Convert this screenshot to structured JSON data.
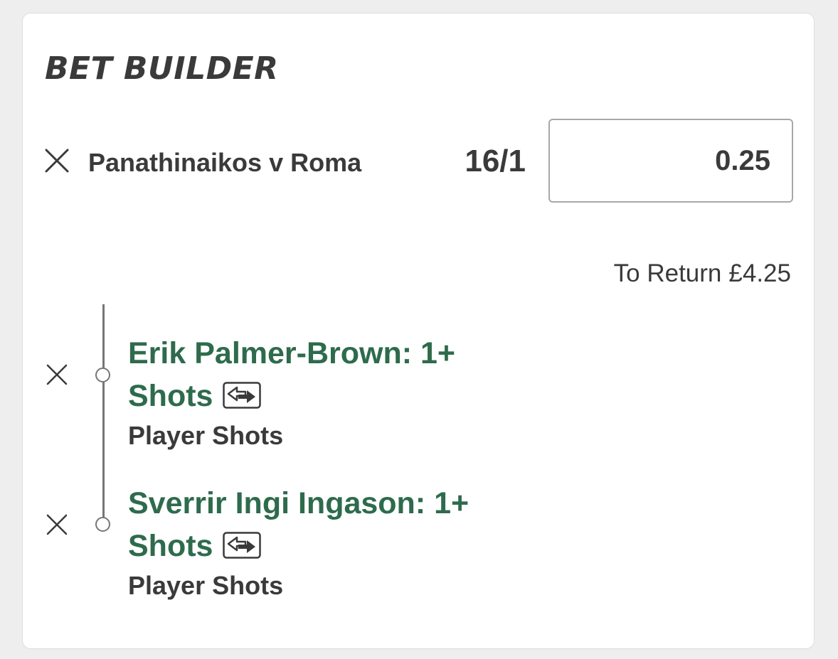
{
  "bet_builder": {
    "title": "BET BUILDER",
    "match": {
      "name": "Panathinaikos v Roma",
      "odds": "16/1",
      "stake": "0.25"
    },
    "to_return": {
      "label": "To Return",
      "value": "£4.25"
    },
    "selections": [
      {
        "line1": "Erik Palmer-Brown: 1+",
        "line2": "Shots",
        "market": "Player Shots"
      },
      {
        "line1": "Sverrir Ingi Ingason: 1+",
        "line2": "Shots",
        "market": "Player Shots"
      }
    ]
  },
  "icons": {
    "remove": "close-icon",
    "swap": "swap-arrows-icon",
    "timeline_node": "circle-node"
  },
  "colors": {
    "selection_green": "#2e6b4c",
    "text_dark": "#3a3a3a",
    "background": "#eeeeee",
    "card": "#ffffff"
  }
}
